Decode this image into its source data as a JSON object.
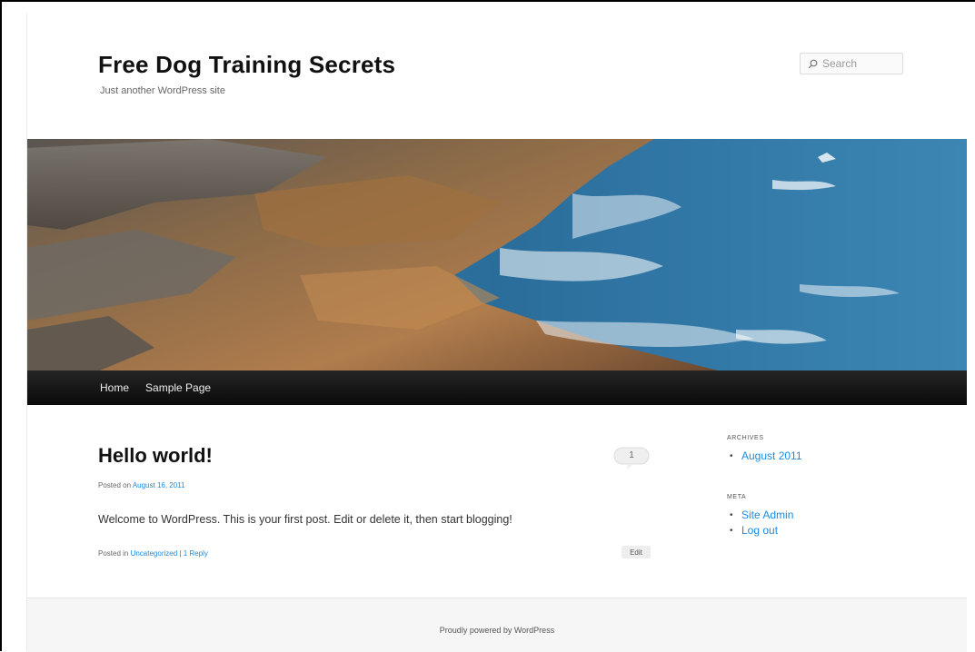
{
  "site": {
    "title": "Free Dog Training Secrets",
    "description": "Just another WordPress site"
  },
  "search": {
    "placeholder": "Search"
  },
  "nav": {
    "items": [
      "Home",
      "Sample Page"
    ]
  },
  "post": {
    "title": "Hello world!",
    "comment_count": "1",
    "posted_on_prefix": "Posted on ",
    "date": "August 16, 2011",
    "content": "Welcome to WordPress. This is your first post. Edit or delete it, then start blogging!",
    "posted_in_prefix": "Posted in ",
    "category": "Uncategorized",
    "separator": " | ",
    "reply_link": "1 Reply",
    "edit_label": "Edit"
  },
  "sidebar": {
    "archives_title": "ARCHIVES",
    "archives": [
      "August 2011"
    ],
    "meta_title": "META",
    "meta_links": [
      "Site Admin",
      "Log out"
    ]
  },
  "footer": {
    "text": "Proudly powered by WordPress"
  },
  "colors": {
    "link": "#1b8be0",
    "nav_bg": "#111111",
    "footer_bg": "#f6f6f6"
  },
  "icons": {
    "search": "search-icon",
    "comment": "comment-bubble-icon"
  }
}
